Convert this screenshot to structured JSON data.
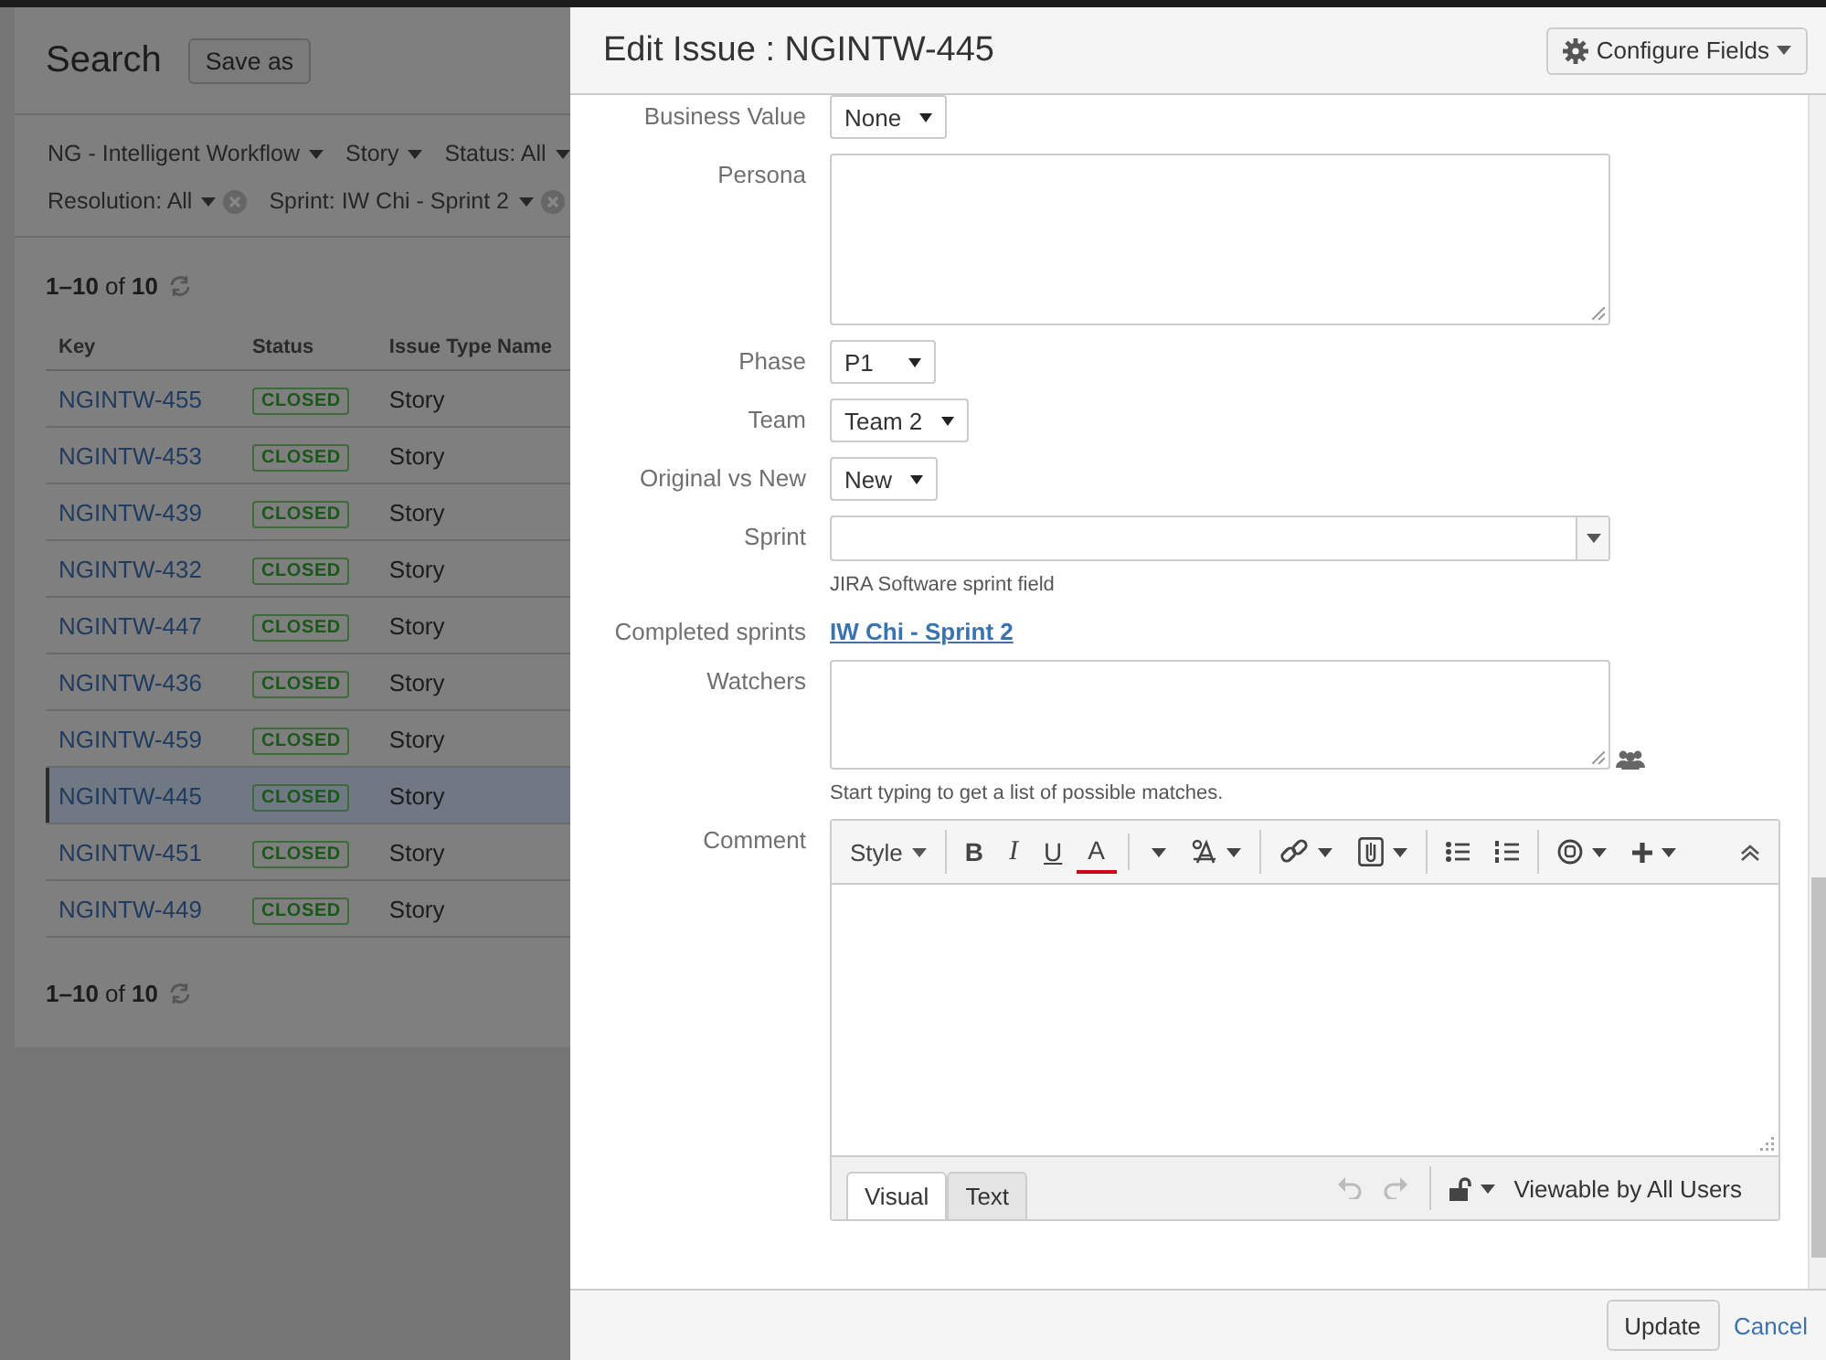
{
  "search": {
    "title": "Search",
    "save_button": "Save as",
    "filter_lines": [
      {
        "filters": [
          {
            "label": "NG - Intelligent Workflow",
            "clearable": false
          },
          {
            "label": "Story",
            "clearable": false
          },
          {
            "label": "Status: All",
            "clearable": false
          }
        ]
      },
      {
        "filters": [
          {
            "label": "Resolution: All",
            "clearable": true
          },
          {
            "label": "Sprint: IW Chi - Sprint 2",
            "clearable": true
          }
        ]
      }
    ],
    "pager_top": "**1–10** of **10**",
    "columns": [
      "Key",
      "Status",
      "Issue Type Name"
    ],
    "rows": [
      {
        "key": "NGINTW-455",
        "status": "CLOSED",
        "type": "Story",
        "selected": false
      },
      {
        "key": "NGINTW-453",
        "status": "CLOSED",
        "type": "Story",
        "selected": false
      },
      {
        "key": "NGINTW-439",
        "status": "CLOSED",
        "type": "Story",
        "selected": false
      },
      {
        "key": "NGINTW-432",
        "status": "CLOSED",
        "type": "Story",
        "selected": false
      },
      {
        "key": "NGINTW-447",
        "status": "CLOSED",
        "type": "Story",
        "selected": false
      },
      {
        "key": "NGINTW-436",
        "status": "CLOSED",
        "type": "Story",
        "selected": false
      },
      {
        "key": "NGINTW-459",
        "status": "CLOSED",
        "type": "Story",
        "selected": false
      },
      {
        "key": "NGINTW-445",
        "status": "CLOSED",
        "type": "Story",
        "selected": true
      },
      {
        "key": "NGINTW-451",
        "status": "CLOSED",
        "type": "Story",
        "selected": false
      },
      {
        "key": "NGINTW-449",
        "status": "CLOSED",
        "type": "Story",
        "selected": false
      }
    ],
    "pager_bottom": "**1–10** of **10**"
  },
  "dialog": {
    "title": "Edit Issue : NGINTW-445",
    "configure_button": "Configure Fields",
    "fields": [
      {
        "label": "Business Value",
        "kind": "select",
        "value": "None"
      },
      {
        "label": "Persona",
        "kind": "textarea"
      },
      {
        "label": "Phase",
        "kind": "select",
        "value": "P1"
      },
      {
        "label": "Team",
        "kind": "select",
        "value": "Team 2"
      },
      {
        "label": "Original vs New",
        "kind": "select",
        "value": "New"
      },
      {
        "label": "Sprint",
        "kind": "combo",
        "help": "JIRA Software sprint field"
      },
      {
        "label": "Completed sprints",
        "kind": "link",
        "value": "IW Chi - Sprint 2"
      },
      {
        "label": "Watchers",
        "kind": "userpicker",
        "help": "Start typing to get a list of possible matches."
      },
      {
        "label": "Comment",
        "kind": "editor"
      }
    ],
    "editor": {
      "toolbar": [
        {
          "items": [
            {
              "kind": "style",
              "label": "Style"
            }
          ]
        },
        {
          "items": [
            {
              "kind": "bold",
              "label": "B"
            },
            {
              "kind": "italic",
              "label": "I"
            },
            {
              "kind": "underline",
              "label": "U"
            },
            {
              "kind": "color",
              "label": "A"
            },
            {
              "kind": "format"
            }
          ]
        },
        {
          "items": [
            {
              "kind": "link"
            },
            {
              "kind": "attach"
            }
          ]
        },
        {
          "items": [
            {
              "kind": "bullets"
            },
            {
              "kind": "numbers"
            }
          ]
        },
        {
          "items": [
            {
              "kind": "emoji"
            },
            {
              "kind": "insert"
            }
          ]
        },
        {
          "items": [
            {
              "kind": "collapse"
            }
          ]
        }
      ],
      "tabs": [
        {
          "label": "Visual",
          "selected": true
        },
        {
          "label": "Text",
          "selected": false
        }
      ],
      "undo": {
        "disabled": true
      },
      "redo": {
        "disabled": true
      },
      "visibility": "Viewable by All Users"
    },
    "footer": {
      "update_button": "Update",
      "cancel_link": "Cancel"
    }
  }
}
